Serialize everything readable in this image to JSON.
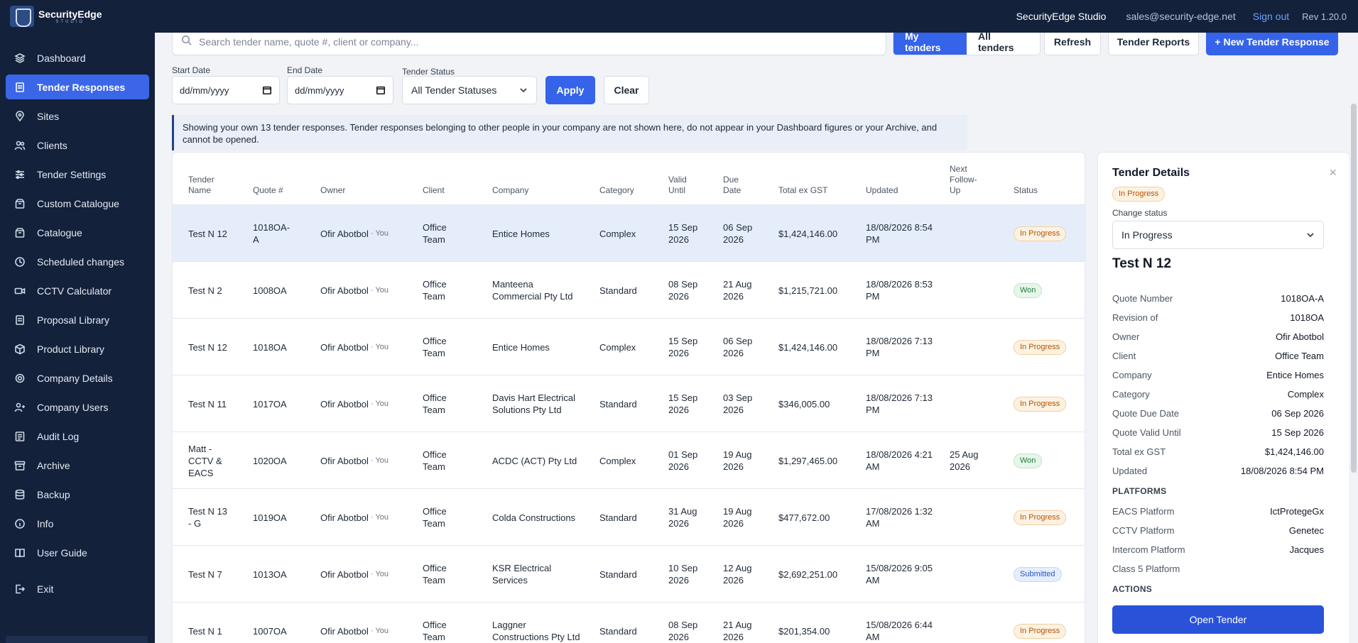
{
  "topbar": {
    "logo_name": "SecurityEdge",
    "logo_sub": "STUDIO",
    "studio_name": "SecurityEdge Studio",
    "user_email": "sales@security-edge.net",
    "signout": "Sign out",
    "revision": "Rev 1.20.0"
  },
  "sidebar": {
    "items": [
      {
        "label": "Dashboard",
        "icon": "layers-icon"
      },
      {
        "label": "Tender Responses",
        "icon": "document-icon"
      },
      {
        "label": "Sites",
        "icon": "map-pin-icon"
      },
      {
        "label": "Clients",
        "icon": "users-icon"
      },
      {
        "label": "Tender Settings",
        "icon": "sliders-icon"
      },
      {
        "label": "Custom Catalogue",
        "icon": "box-icon"
      },
      {
        "label": "Catalogue",
        "icon": "box-icon"
      },
      {
        "label": "Scheduled changes",
        "icon": "clock-icon"
      },
      {
        "label": "CCTV Calculator",
        "icon": "camera-icon"
      },
      {
        "label": "Proposal Library",
        "icon": "document-icon"
      },
      {
        "label": "Product Library",
        "icon": "package-icon"
      },
      {
        "label": "Company Details",
        "icon": "gear-icon"
      },
      {
        "label": "Company Users",
        "icon": "user-plus-icon"
      },
      {
        "label": "Audit Log",
        "icon": "list-icon"
      },
      {
        "label": "Archive",
        "icon": "archive-icon"
      },
      {
        "label": "Backup",
        "icon": "database-icon"
      },
      {
        "label": "Info",
        "icon": "info-icon"
      },
      {
        "label": "User Guide",
        "icon": "book-icon"
      },
      {
        "label": "Exit",
        "icon": "exit-icon"
      }
    ]
  },
  "toolbar": {
    "search_placeholder": "Search tender name, quote #, client or company...",
    "my_tenders": "My tenders",
    "all_tenders": "All tenders",
    "refresh": "Refresh",
    "tender_reports": "Tender Reports",
    "new_tender": "+ New Tender Response"
  },
  "filters": {
    "start_date_label": "Start Date",
    "start_date_value": "dd/mm/yyyy",
    "end_date_label": "End Date",
    "end_date_value": "dd/mm/yyyy",
    "status_label": "Tender Status",
    "status_value": "All Tender Statuses",
    "apply": "Apply",
    "clear": "Clear"
  },
  "banner": {
    "text": "Showing your own 13 tender responses. Tender responses belonging to other people in your company are not shown here, do not appear in your Dashboard figures or your Archive, and cannot be opened."
  },
  "table": {
    "headers": {
      "name": "Tender Name",
      "quote": "Quote #",
      "owner": "Owner",
      "client": "Client",
      "company": "Company",
      "category": "Category",
      "valid": "Valid Until",
      "due": "Due Date",
      "total": "Total ex GST",
      "updated": "Updated",
      "followup": "Next Follow-Up",
      "status": "Status"
    },
    "rows": [
      {
        "name": "Test N 12",
        "quote": "1018OA-A",
        "owner": "Ofir Abotbol",
        "you": "· You",
        "client": "Office Team",
        "company": "Entice Homes",
        "category": "Complex",
        "valid": "15 Sep 2026",
        "due": "06 Sep 2026",
        "total": "$1,424,146.00",
        "updated": "18/08/2026 8:54 PM",
        "followup": "",
        "status": "In Progress"
      },
      {
        "name": "Test N 2",
        "quote": "1008OA",
        "owner": "Ofir Abotbol",
        "you": "· You",
        "client": "Office Team",
        "company": "Manteena Commercial Pty Ltd",
        "category": "Standard",
        "valid": "08 Sep 2026",
        "due": "21 Aug 2026",
        "total": "$1,215,721.00",
        "updated": "18/08/2026 8:53 PM",
        "followup": "",
        "status": "Won"
      },
      {
        "name": "Test N 12",
        "quote": "1018OA",
        "owner": "Ofir Abotbol",
        "you": "· You",
        "client": "Office Team",
        "company": "Entice Homes",
        "category": "Complex",
        "valid": "15 Sep 2026",
        "due": "06 Sep 2026",
        "total": "$1,424,146.00",
        "updated": "18/08/2026 7:13 PM",
        "followup": "",
        "status": "In Progress"
      },
      {
        "name": "Test N 11",
        "quote": "1017OA",
        "owner": "Ofir Abotbol",
        "you": "· You",
        "client": "Office Team",
        "company": "Davis Hart Electrical Solutions Pty Ltd",
        "category": "Standard",
        "valid": "15 Sep 2026",
        "due": "03 Sep 2026",
        "total": "$346,005.00",
        "updated": "18/08/2026 7:13 PM",
        "followup": "",
        "status": "In Progress"
      },
      {
        "name": "Matt - CCTV & EACS",
        "quote": "1020OA",
        "owner": "Ofir Abotbol",
        "you": "· You",
        "client": "Office Team",
        "company": "ACDC (ACT) Pty Ltd",
        "category": "Complex",
        "valid": "01 Sep 2026",
        "due": "19 Aug 2026",
        "total": "$1,297,465.00",
        "updated": "18/08/2026 4:21 AM",
        "followup": "25 Aug 2026",
        "status": "Won"
      },
      {
        "name": "Test N 13 - G",
        "quote": "1019OA",
        "owner": "Ofir Abotbol",
        "you": "· You",
        "client": "Office Team",
        "company": "Colda Constructions",
        "category": "Standard",
        "valid": "31 Aug 2026",
        "due": "19 Aug 2026",
        "total": "$477,672.00",
        "updated": "17/08/2026 1:32 AM",
        "followup": "",
        "status": "In Progress"
      },
      {
        "name": "Test N 7",
        "quote": "1013OA",
        "owner": "Ofir Abotbol",
        "you": "· You",
        "client": "Office Team",
        "company": "KSR Electrical Services",
        "category": "Standard",
        "valid": "10 Sep 2026",
        "due": "12 Aug 2026",
        "total": "$2,692,251.00",
        "updated": "15/08/2026 9:05 AM",
        "followup": "",
        "status": "Submitted"
      },
      {
        "name": "Test N 1",
        "quote": "1007OA",
        "owner": "Ofir Abotbol",
        "you": "· You",
        "client": "Office Team",
        "company": "Laggner Constructions Pty Ltd",
        "category": "Standard",
        "valid": "08 Sep 2026",
        "due": "21 Aug 2026",
        "total": "$201,354.00",
        "updated": "15/08/2026 6:44 AM",
        "followup": "",
        "status": "In Progress"
      }
    ]
  },
  "details": {
    "title": "Tender Details",
    "status_badge": "In Progress",
    "change_status_label": "Change status",
    "change_status_value": "In Progress",
    "name": "Test N 12",
    "fields": [
      {
        "k": "Quote Number",
        "v": "1018OA-A"
      },
      {
        "k": "Revision of",
        "v": "1018OA"
      },
      {
        "k": "Owner",
        "v": "Ofir Abotbol"
      },
      {
        "k": "Client",
        "v": "Office Team"
      },
      {
        "k": "Company",
        "v": "Entice Homes"
      },
      {
        "k": "Category",
        "v": "Complex"
      },
      {
        "k": "Quote Due Date",
        "v": "06 Sep 2026"
      },
      {
        "k": "Quote Valid Until",
        "v": "15 Sep 2026"
      },
      {
        "k": "Total ex GST",
        "v": "$1,424,146.00"
      },
      {
        "k": "Updated",
        "v": "18/08/2026 8:54 PM"
      }
    ],
    "platforms_heading": "PLATFORMS",
    "platforms": [
      {
        "k": "EACS Platform",
        "v": "IctProtegeGx"
      },
      {
        "k": "CCTV Platform",
        "v": "Genetec"
      },
      {
        "k": "Intercom Platform",
        "v": "Jacques"
      },
      {
        "k": "Class 5 Platform",
        "v": ""
      }
    ],
    "actions_heading": "ACTIONS",
    "open_button": "Open Tender"
  },
  "colors": {
    "nav_bg": "#13213b",
    "accent": "#3563e9",
    "selected_row": "#e6edfa"
  }
}
